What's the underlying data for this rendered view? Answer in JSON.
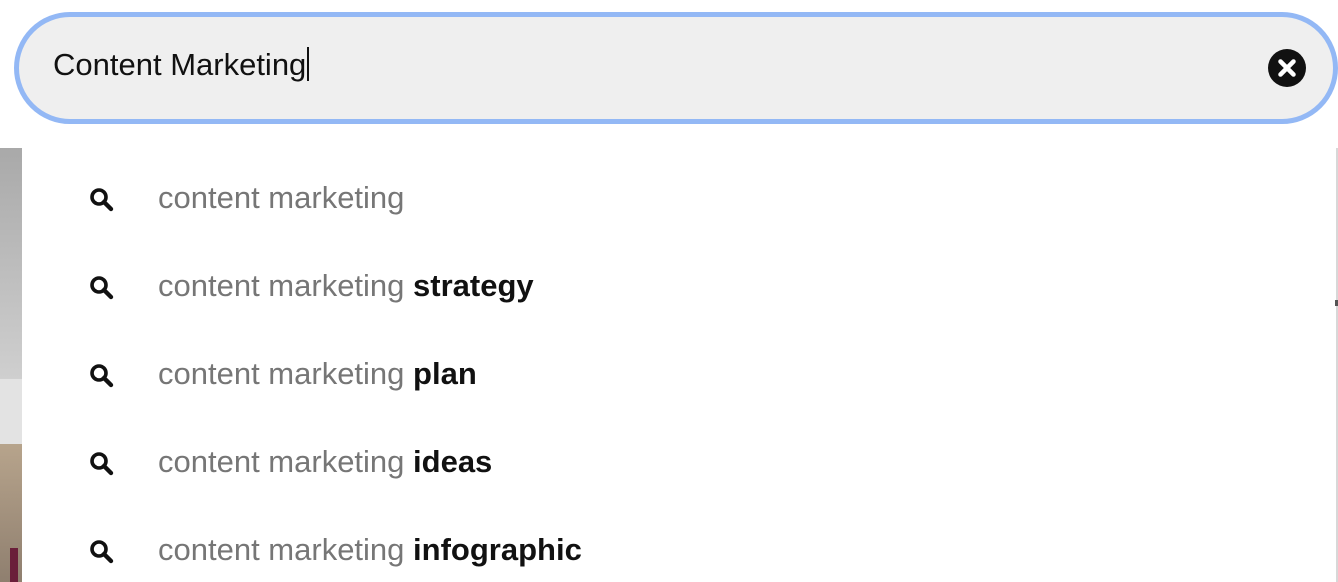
{
  "search": {
    "value": "Content Marketing",
    "clear_icon": "close-circle-icon"
  },
  "suggestions": [
    {
      "prefix": "content marketing",
      "suffix": "",
      "icon": "search-icon"
    },
    {
      "prefix": "content marketing ",
      "suffix": "strategy",
      "icon": "search-icon"
    },
    {
      "prefix": "content marketing ",
      "suffix": "plan",
      "icon": "search-icon"
    },
    {
      "prefix": "content marketing ",
      "suffix": "ideas",
      "icon": "search-icon"
    },
    {
      "prefix": "content marketing ",
      "suffix": "infographic",
      "icon": "search-icon"
    }
  ],
  "colors": {
    "focus_ring": "#93b8f5",
    "input_bg": "#efefef",
    "prefix_text": "#767676",
    "suffix_text": "#111111"
  }
}
